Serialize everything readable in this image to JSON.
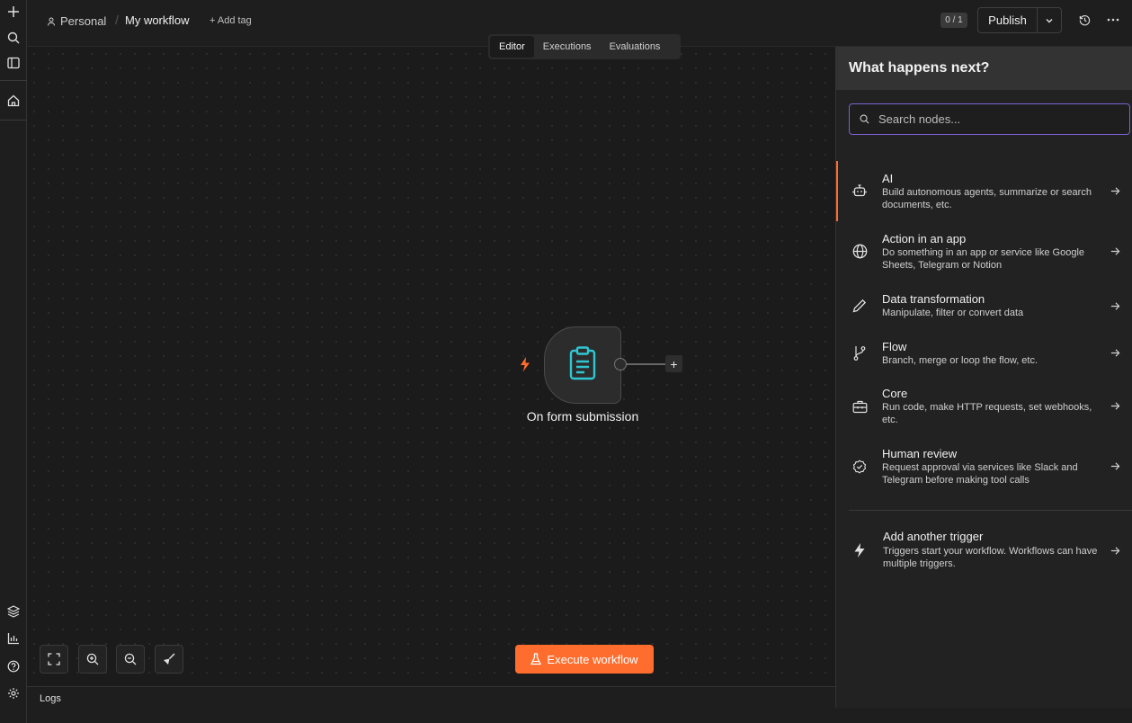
{
  "breadcrumb": {
    "owner": "Personal",
    "workflow_name": "My workflow",
    "add_tag": "+ Add tag"
  },
  "header": {
    "counter": "0 / 1",
    "publish_label": "Publish"
  },
  "tabs": [
    {
      "label": "Editor",
      "active": true
    },
    {
      "label": "Executions",
      "active": false
    },
    {
      "label": "Evaluations",
      "active": false
    }
  ],
  "canvas": {
    "node": {
      "label": "On form submission",
      "icon": "clipboard-icon",
      "icon_color": "#2fc7d3"
    },
    "execute_label": "Execute workflow",
    "accent": "#ff6d2e"
  },
  "logs_label": "Logs",
  "panel": {
    "title": "What happens next?",
    "search_placeholder": "Search nodes...",
    "items": [
      {
        "title": "AI",
        "desc": "Build autonomous agents, summarize or search documents, etc.",
        "icon": "robot-icon"
      },
      {
        "title": "Action in an app",
        "desc": "Do something in an app or service like Google Sheets, Telegram or Notion",
        "icon": "globe-icon"
      },
      {
        "title": "Data transformation",
        "desc": "Manipulate, filter or convert data",
        "icon": "pencil-icon"
      },
      {
        "title": "Flow",
        "desc": "Branch, merge or loop the flow, etc.",
        "icon": "branch-icon"
      },
      {
        "title": "Core",
        "desc": "Run code, make HTTP requests, set webhooks, etc.",
        "icon": "toolbox-icon"
      },
      {
        "title": "Human review",
        "desc": "Request approval via services like Slack and Telegram before making tool calls",
        "icon": "check-badge-icon"
      }
    ],
    "trigger": {
      "title": "Add another trigger",
      "desc": "Triggers start your workflow. Workflows can have multiple triggers.",
      "icon": "bolt-icon"
    }
  }
}
